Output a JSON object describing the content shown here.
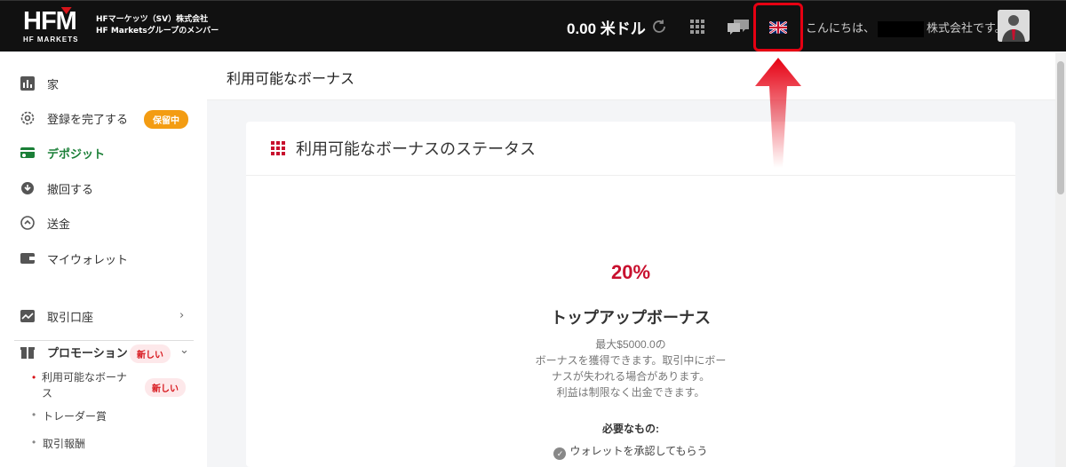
{
  "header": {
    "logo_text": "HFM",
    "logo_sub": "HF MARKETS",
    "company_line1": "HFマーケッツ（SV）株式会社",
    "company_line2": "HF Marketsグループのメンバー",
    "balance": "0.00 米ドル",
    "greeting_prefix": "こんにちは、",
    "greeting_suffix": "株式会社です。",
    "icons": [
      "refresh-icon",
      "apps-grid-icon",
      "chat-icon",
      "uk-flag-icon",
      "avatar"
    ]
  },
  "sidebar": {
    "items": [
      {
        "label": "家",
        "icon": "dashboard-icon"
      },
      {
        "label": "登録を完了する",
        "icon": "gear-icon",
        "badge": "保留中"
      },
      {
        "label": "デポジット",
        "icon": "deposit-icon"
      },
      {
        "label": "撤回する",
        "icon": "withdraw-icon"
      },
      {
        "label": "送金",
        "icon": "transfer-icon"
      },
      {
        "label": "マイウォレット",
        "icon": "wallet-icon"
      },
      {
        "label": "取引口座",
        "icon": "chart-icon"
      },
      {
        "label": "プロモーション",
        "icon": "gift-icon",
        "badge": "新しい"
      }
    ],
    "sub_items": [
      {
        "label": "利用可能なボーナス",
        "badge": "新しい"
      },
      {
        "label": "トレーダー賞"
      },
      {
        "label": "取引報酬"
      }
    ]
  },
  "main": {
    "page_title": "利用可能なボーナス",
    "card_title": "利用可能なボーナスのステータス",
    "bonus_percent": "20%",
    "bonus_name": "トップアップボーナス",
    "desc_line1": "最大$5000.0の",
    "desc_line2": "ボーナスを獲得できます。取引中にボー",
    "desc_line3": "ナスが失われる場合があります。",
    "desc_line4": "利益は制限なく出金できます。",
    "requirements_title": "必要なもの:",
    "requirement_1": "ウォレットを承認してもらう"
  },
  "colors": {
    "topbar": "#111111",
    "accent_red": "#c8102e",
    "active_green": "#1a7f37",
    "badge_orange": "#f39c12"
  }
}
